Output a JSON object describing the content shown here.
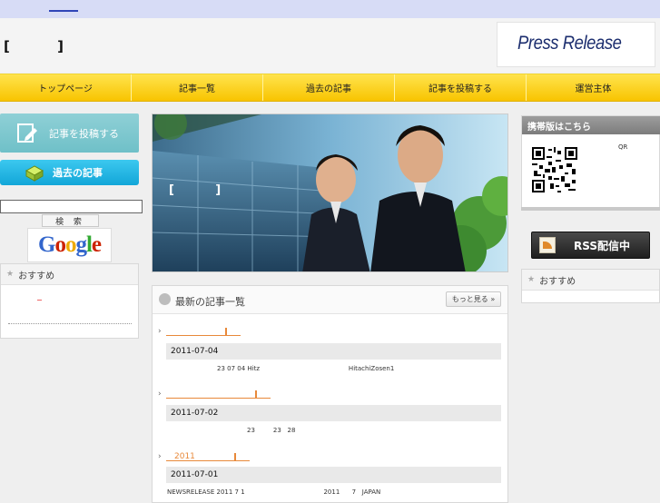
{
  "header": {
    "site_title": "[          ]",
    "logo_text": "Press Release"
  },
  "nav": {
    "items": [
      "トップページ",
      "記事一覧",
      "過去の記事",
      "記事を投稿する",
      "運営主体"
    ]
  },
  "sidebar_left": {
    "post_button": "記事を投稿する",
    "archive_button": "過去の記事",
    "search_placeholder": "",
    "search_button": "検 索",
    "google_letters": [
      "G",
      "o",
      "o",
      "g",
      "l",
      "e"
    ],
    "recommend_title": "おすすめ"
  },
  "hero": {
    "title": "[          ]"
  },
  "latest": {
    "title": "最新の記事一覧",
    "more_button": "もっと見る »",
    "articles": [
      {
        "link_text": "",
        "date": "2011-07-04",
        "summary": "23 07 04 Hitz                                            HitachiZosen1"
      },
      {
        "link_text": "",
        "date": "2011-07-02",
        "summary": "23         23   28"
      },
      {
        "link_text": "2011",
        "date": "2011-07-01",
        "summary": "NEWSRELEASE 2011 7 1                                       2011      7   JAPAN"
      }
    ]
  },
  "sidebar_right": {
    "mobile_title": "携帯版はこちら",
    "qr_label": "QR",
    "rss_button": "RSS配信中",
    "recommend_title": "おすすめ"
  },
  "colors": {
    "nav_yellow": "#f8c400",
    "accent_orange": "#e8893a",
    "teal": "#6fc0c8",
    "cyan": "#12a6d8"
  }
}
